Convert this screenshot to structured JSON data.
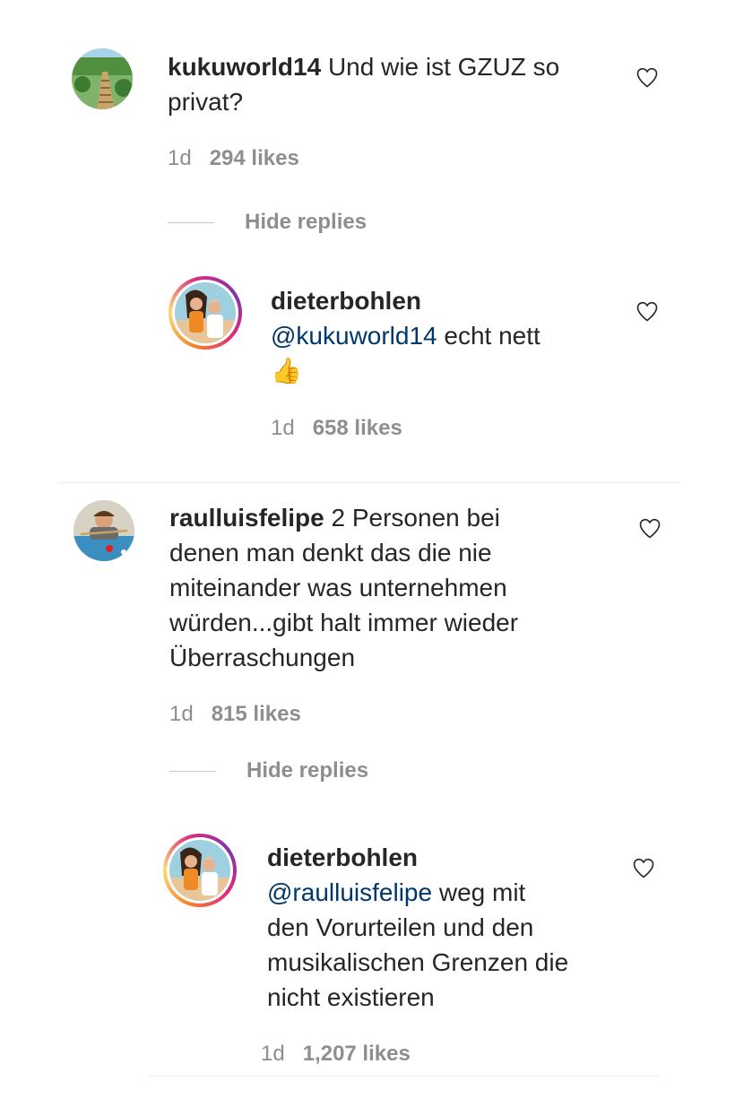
{
  "comments": [
    {
      "username": "kukuworld14",
      "text": "Und wie ist GZUZ so privat?",
      "time": "1d",
      "likes": "294 likes",
      "hide_replies": "Hide replies",
      "reply": {
        "username": "dieterbohlen",
        "mention": "@kukuworld14",
        "text": "echt nett",
        "emoji": "👍",
        "time": "1d",
        "likes": "658 likes"
      }
    },
    {
      "username": "raulluisfelipe",
      "text_line1": "2 Personen bei",
      "text_line2": "denen man denkt das die nie",
      "text_line3": "miteinander was unternehmen",
      "text_line4": "würden...gibt halt immer wieder",
      "text_line5": "Überraschungen",
      "time": "1d",
      "likes": "815 likes",
      "hide_replies": "Hide replies",
      "reply": {
        "username": "dieterbohlen",
        "mention": "@raulluisfelipe",
        "text_line1": "weg mit",
        "text_line2": "den Vorurteilen und den",
        "text_line3": "musikalischen Grenzen die",
        "text_line4": "nicht existieren",
        "time": "1d",
        "likes": "1,207 likes"
      }
    }
  ],
  "icons": {
    "like": "heart-outline-icon",
    "avatar_kuku": "path-landscape-avatar",
    "avatar_dieter": "couple-photo-avatar",
    "avatar_raul": "billiards-avatar"
  }
}
